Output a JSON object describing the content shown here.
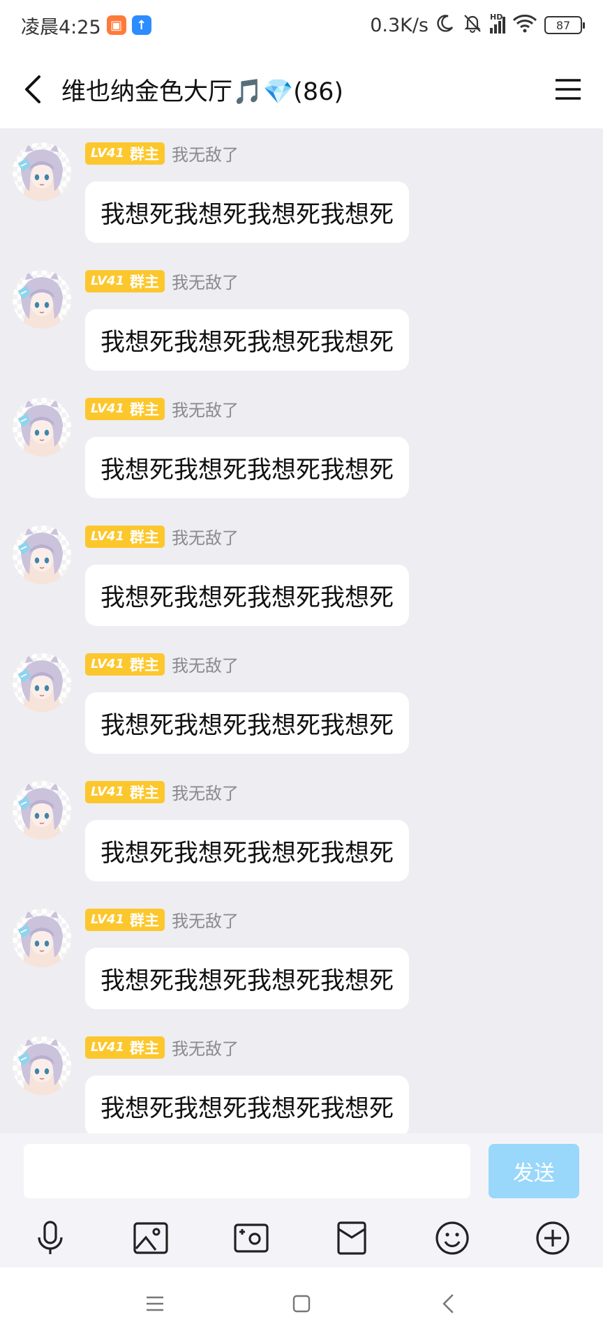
{
  "status_bar": {
    "time": "凌晨4:25",
    "network_speed": "0.3K/s",
    "signal_label": "HD",
    "battery": "87"
  },
  "header": {
    "title": "维也纳金色大厅🎵💎(86)"
  },
  "messages": [
    {
      "level": "LV41",
      "role": "群主",
      "nickname": "我无敌了",
      "text": "我想死我想死我想死我想死"
    },
    {
      "level": "LV41",
      "role": "群主",
      "nickname": "我无敌了",
      "text": "我想死我想死我想死我想死"
    },
    {
      "level": "LV41",
      "role": "群主",
      "nickname": "我无敌了",
      "text": "我想死我想死我想死我想死"
    },
    {
      "level": "LV41",
      "role": "群主",
      "nickname": "我无敌了",
      "text": "我想死我想死我想死我想死"
    },
    {
      "level": "LV41",
      "role": "群主",
      "nickname": "我无敌了",
      "text": "我想死我想死我想死我想死"
    },
    {
      "level": "LV41",
      "role": "群主",
      "nickname": "我无敌了",
      "text": "我想死我想死我想死我想死"
    },
    {
      "level": "LV41",
      "role": "群主",
      "nickname": "我无敌了",
      "text": "我想死我想死我想死我想死"
    },
    {
      "level": "LV41",
      "role": "群主",
      "nickname": "我无敌了",
      "text": "我想死我想死我想死我想死"
    }
  ],
  "composer": {
    "input_value": "",
    "send_label": "发送"
  },
  "toolbar_icons": [
    "microphone-icon",
    "image-icon",
    "camera-icon",
    "red-packet-icon",
    "emoji-icon",
    "plus-icon"
  ],
  "colors": {
    "accent": "#99d7fb",
    "badge": "#fcc72d",
    "background": "#ededf2"
  }
}
